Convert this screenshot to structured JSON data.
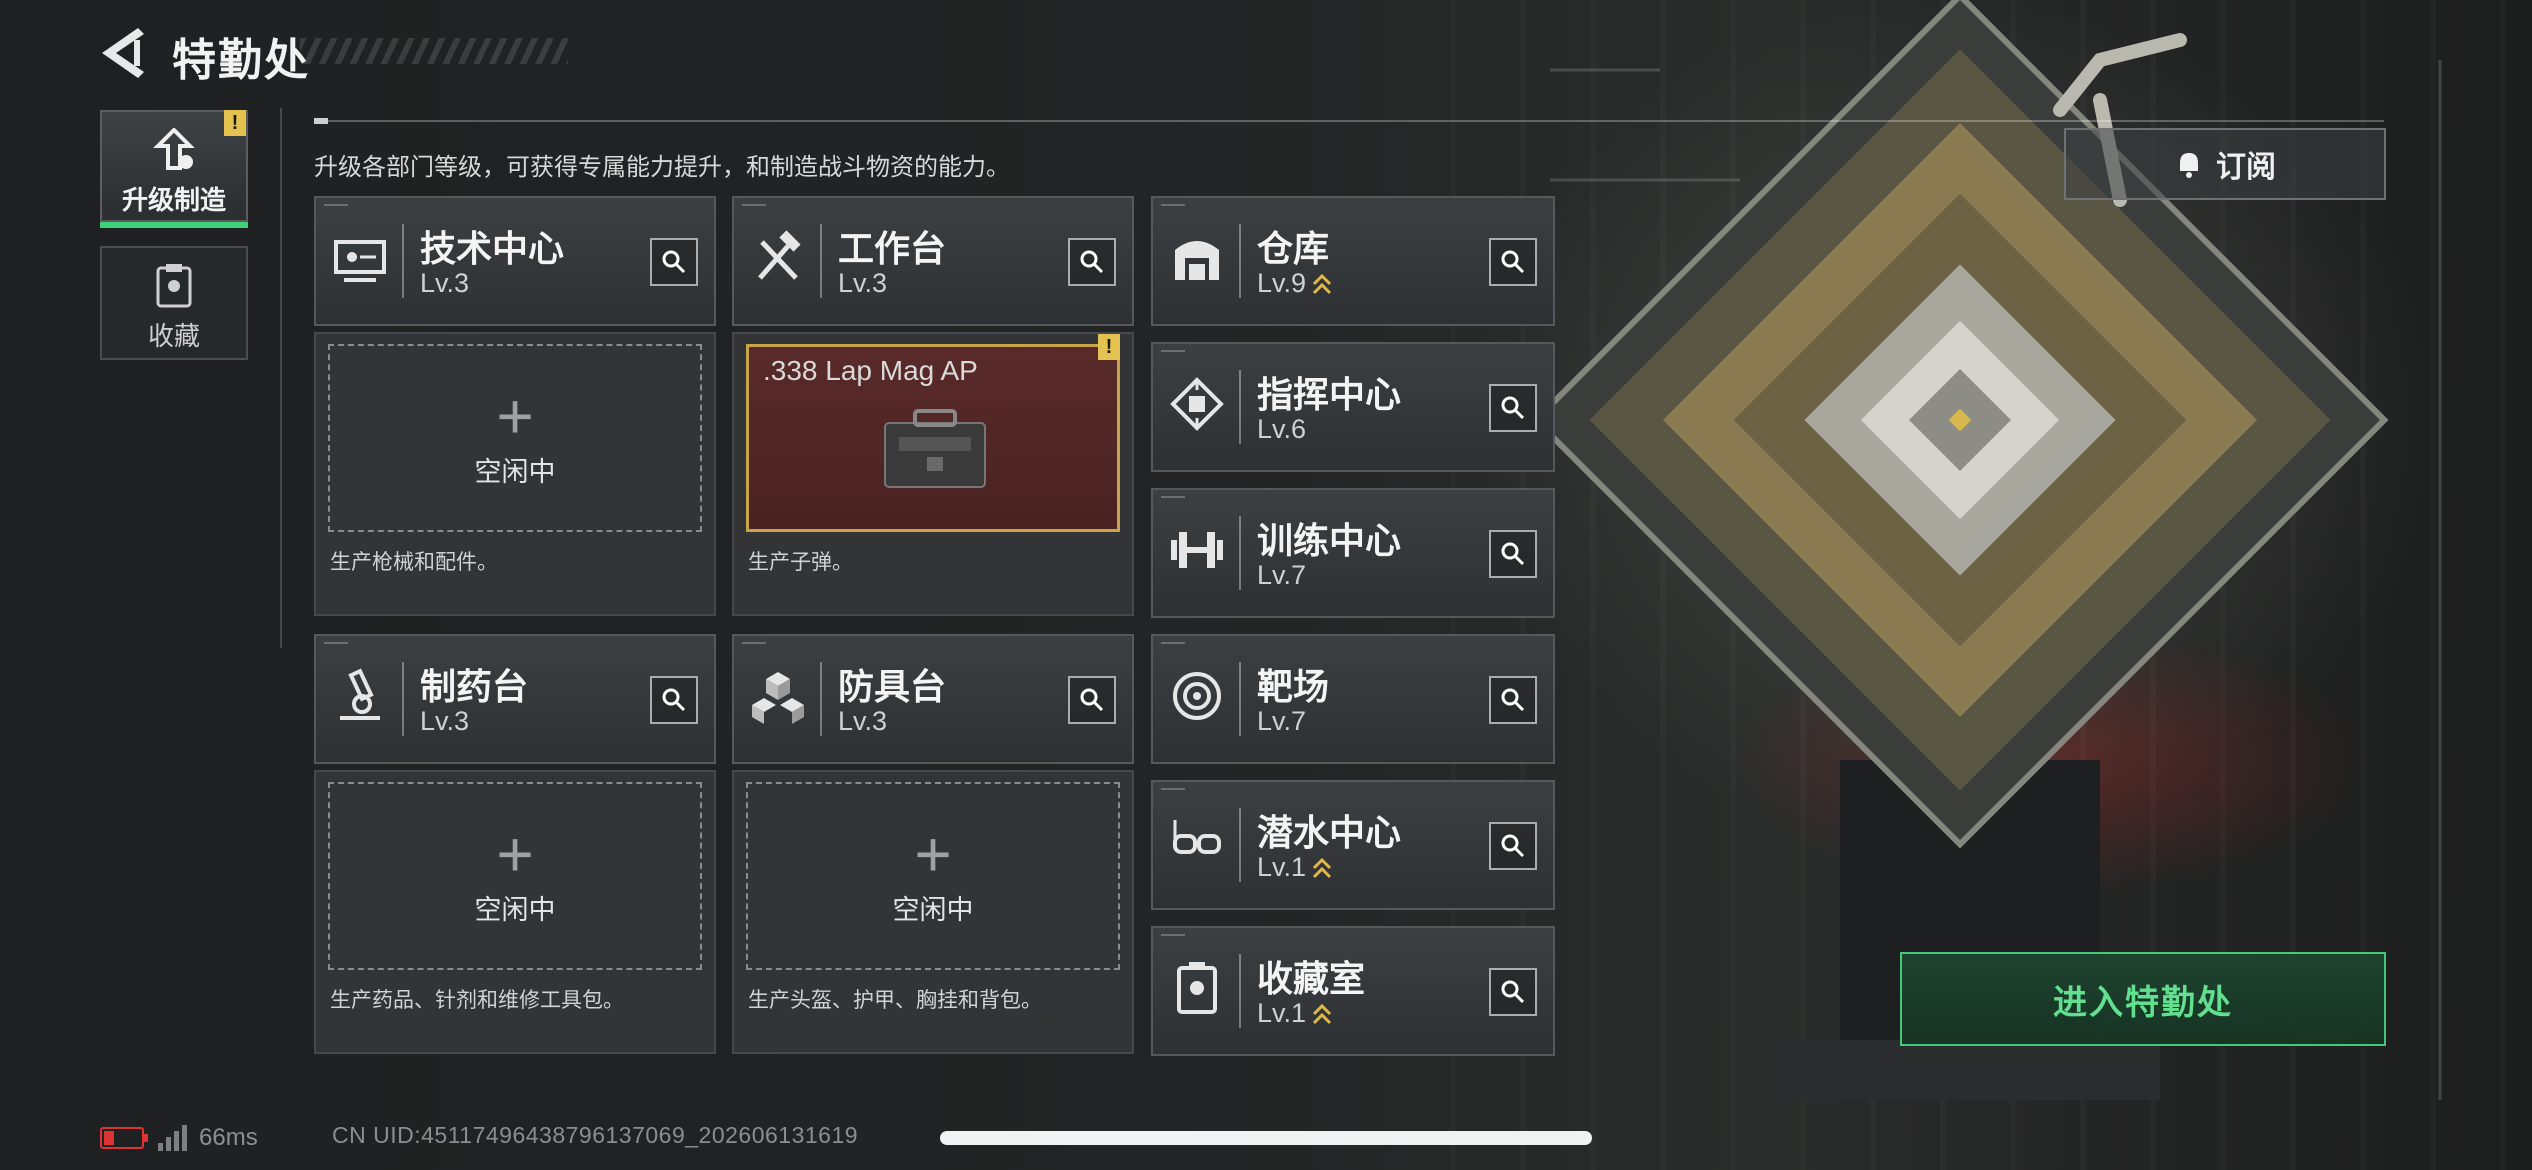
{
  "header": {
    "title": "特勤处",
    "description": "升级各部门等级，可获得专属能力提升，和制造战斗物资的能力。"
  },
  "side_tabs": [
    {
      "label": "升级制造",
      "active": true,
      "warning": "!"
    },
    {
      "label": "收藏",
      "active": false
    }
  ],
  "stations": {
    "tech_center": {
      "name": "技术中心",
      "level": "Lv.3",
      "status": "空闲中",
      "production": "生产枪械和配件。"
    },
    "workbench": {
      "name": "工作台",
      "level": "Lv.3",
      "crafting_item": ".338 Lap Mag AP",
      "warning": "!",
      "production": "生产子弹。"
    },
    "pharmacy": {
      "name": "制药台",
      "level": "Lv.3",
      "status": "空闲中",
      "production": "生产药品、针剂和维修工具包。"
    },
    "armor_bench": {
      "name": "防具台",
      "level": "Lv.3",
      "status": "空闲中",
      "production": "生产头盔、护甲、胸挂和背包。"
    },
    "warehouse": {
      "name": "仓库",
      "level": "Lv.9",
      "upgradable": true
    },
    "command_center": {
      "name": "指挥中心",
      "level": "Lv.6"
    },
    "training_center": {
      "name": "训练中心",
      "level": "Lv.7"
    },
    "shooting_range": {
      "name": "靶场",
      "level": "Lv.7"
    },
    "diving_center": {
      "name": "潜水中心",
      "level": "Lv.1",
      "upgradable": true
    },
    "collection_room": {
      "name": "收藏室",
      "level": "Lv.1",
      "upgradable": true
    }
  },
  "subscribe": {
    "label": "订阅"
  },
  "enter": {
    "label": "进入特勤处"
  },
  "status_bar": {
    "ping": "66ms",
    "uid": "CN UID:4511749643879613706​9_202606131619"
  },
  "colors": {
    "accent_green": "#45c87a",
    "warning_yellow": "#e3c24f",
    "upgrade_gold": "#e0b84a",
    "craft_bg": "#5a2a2a"
  }
}
